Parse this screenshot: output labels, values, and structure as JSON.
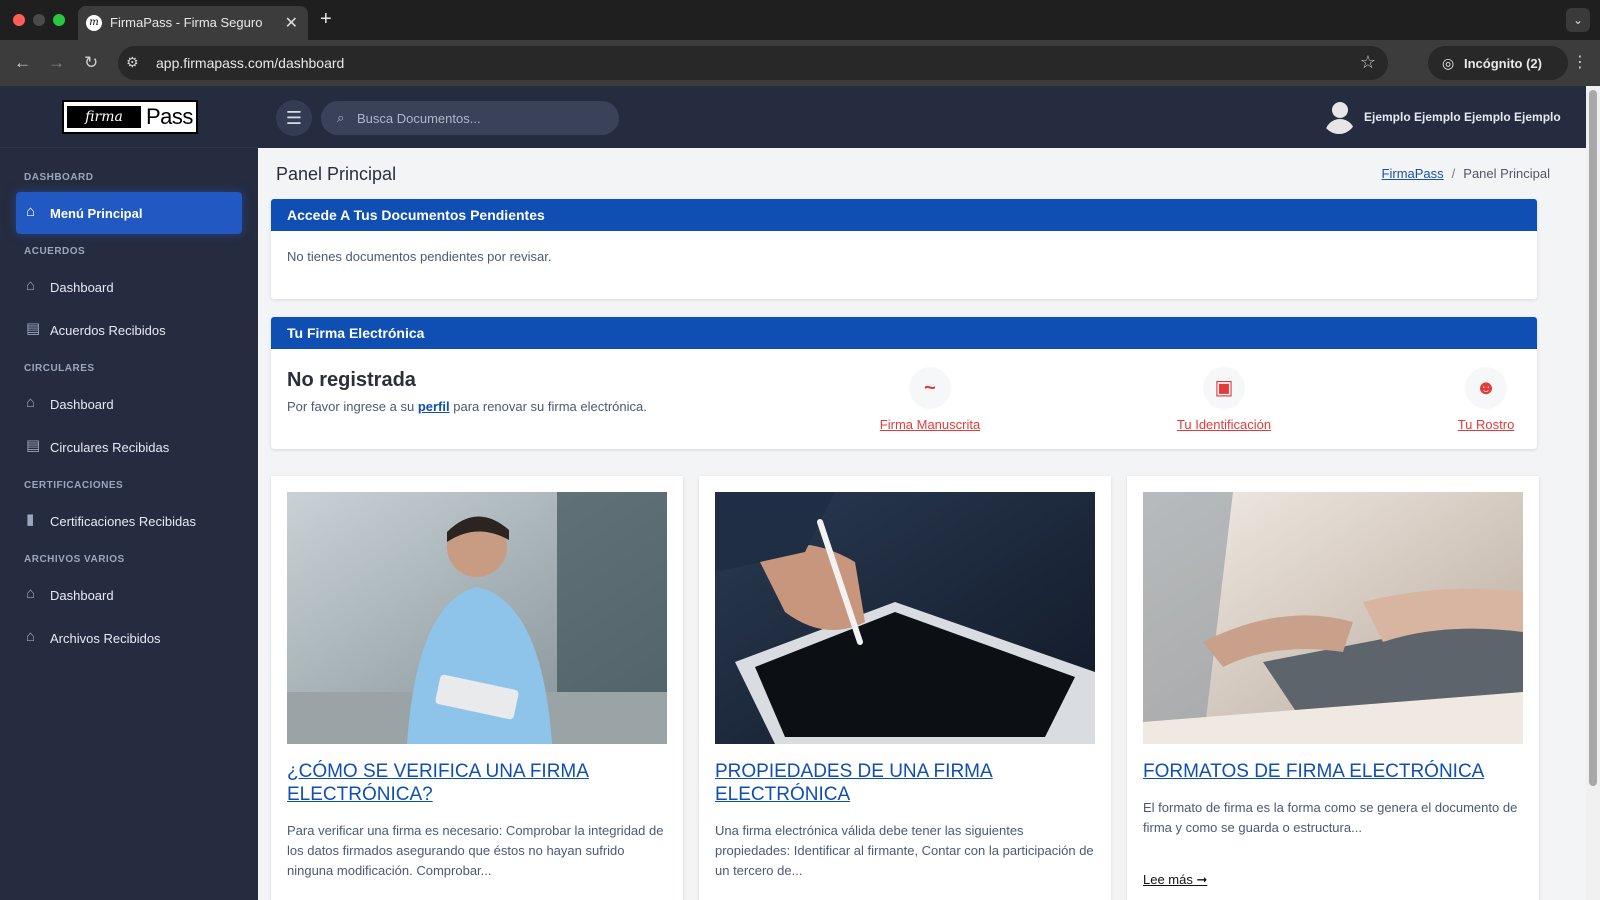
{
  "browser": {
    "tab_title": "FirmaPass - Firma Seguro",
    "url": "app.firmapass.com/dashboard",
    "incognito_label": "Incógnito (2)"
  },
  "logo": {
    "part1": "firma",
    "part2": "Pass"
  },
  "sidebar": {
    "sections": [
      {
        "label": "DASHBOARD"
      },
      {
        "label": "ACUERDOS"
      },
      {
        "label": "CIRCULARES"
      },
      {
        "label": "CERTIFICACIONES"
      },
      {
        "label": "ARCHIVOS VARIOS"
      }
    ],
    "items": [
      {
        "label": "Menú Principal",
        "icon": "home-icon"
      },
      {
        "label": "Dashboard",
        "icon": "home-icon"
      },
      {
        "label": "Acuerdos Recibidos",
        "icon": "document-list-icon"
      },
      {
        "label": "Dashboard",
        "icon": "home-icon"
      },
      {
        "label": "Circulares Recibidas",
        "icon": "document-list-icon"
      },
      {
        "label": "Certificaciones Recibidas",
        "icon": "certificate-icon"
      },
      {
        "label": "Dashboard",
        "icon": "home-icon"
      },
      {
        "label": "Archivos Recibidos",
        "icon": "home-icon"
      }
    ]
  },
  "header": {
    "search_placeholder": "Busca Documentos...",
    "user_name": "Ejemplo Ejemplo Ejemplo Ejemplo"
  },
  "page": {
    "title": "Panel Principal",
    "breadcrumb": {
      "root": "FirmaPass",
      "current": "Panel Principal"
    }
  },
  "pending": {
    "header": "Accede A Tus Documentos Pendientes",
    "message": "No tienes documentos pendientes por revisar."
  },
  "signature": {
    "header": "Tu Firma Electrónica",
    "status": "No registrada",
    "desc_before": "Por favor ingrese a su",
    "desc_link": "perfil",
    "desc_after": "para renovar su firma electrónica.",
    "options": [
      {
        "label": "Firma Manuscrita",
        "icon": "signature-icon"
      },
      {
        "label": "Tu Identificación",
        "icon": "id-card-icon"
      },
      {
        "label": "Tu Rostro",
        "icon": "face-icon"
      }
    ],
    "accent_color": "#e23b3b"
  },
  "articles": [
    {
      "title": "¿CÓMO SE VERIFICA UNA FIRMA ELECTRÓNICA?",
      "excerpt": "Para verificar una firma es necesario: Comprobar la integridad de los datos firmados asegurando que éstos no hayan sufrido ninguna modificación. Comprobar..."
    },
    {
      "title": "PROPIEDADES DE UNA FIRMA ELECTRÓNICA",
      "excerpt": "Una firma electrónica válida debe tener las siguientes propiedades: Identificar al firmante, Contar con la participación de un tercero de..."
    },
    {
      "title": "FORMATOS DE FIRMA ELECTRÓNICA",
      "excerpt": "El formato de firma es la forma como se genera el documento de firma y como se guarda o estructura...",
      "more": "Lee más ➞"
    }
  ],
  "colors": {
    "sidebar_bg": "#252c40",
    "primary": "#0f4fb3",
    "active_nav": "#2158c2"
  }
}
